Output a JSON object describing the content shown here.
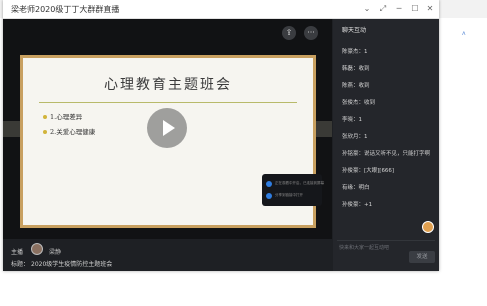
{
  "window": {
    "title": "梁老师2020级丁丁大群群直播"
  },
  "controls": {
    "more": "···"
  },
  "slide": {
    "title": "心理教育主题班会",
    "items": [
      "1.心理差异",
      "2.关爱心理健康"
    ]
  },
  "popup": {
    "rows": [
      {
        "text": "正在观看中开启，已连接到屏幕"
      },
      {
        "text": "分享到链接中打开"
      }
    ]
  },
  "info": {
    "host_label": "主播",
    "host_name": "梁静",
    "subject_label": "标题：",
    "subject": "2020级学生疫情防控主题班会"
  },
  "chat": {
    "header": "聊天互动",
    "messages": [
      "陈豪杰：1",
      "韩磊：收到",
      "陈燕：收到",
      "张俊杰：收到",
      "李晓：1",
      "张欣月：1",
      "孙铭豪：说话又听不见，只能打字啊",
      "孙俊豪：[大眼][666]",
      "有缘：明白",
      "孙俊豪：+1"
    ],
    "input_placeholder": "快来和大家一起互动吧",
    "send_label": "发送"
  }
}
